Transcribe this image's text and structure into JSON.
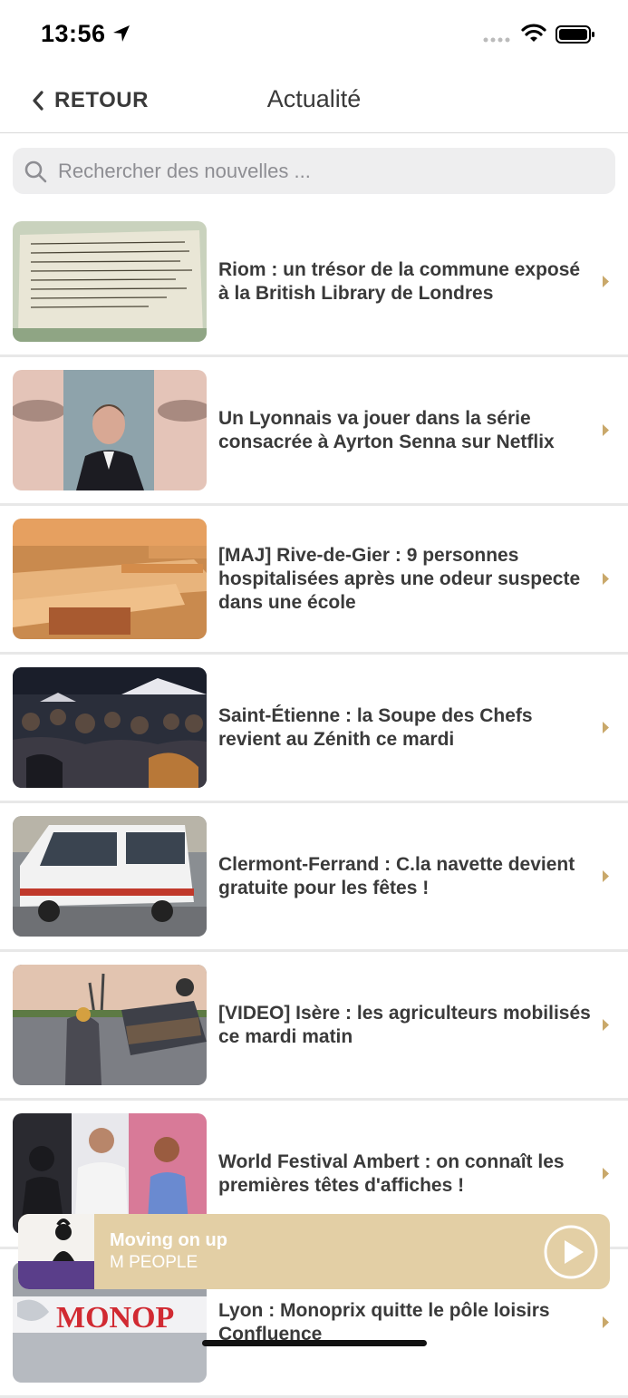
{
  "status_bar": {
    "time": "13:56"
  },
  "nav": {
    "back_label": "RETOUR",
    "title": "Actualité"
  },
  "search": {
    "placeholder": "Rechercher des nouvelles ..."
  },
  "articles": [
    {
      "headline": "Riom : un trésor de la commune exposé à la British Library de Londres",
      "image": "manuscript-photo"
    },
    {
      "headline": "Un Lyonnais va jouer dans la série consacrée à Ayrton Senna sur Netflix",
      "image": "actor-portrait-photo"
    },
    {
      "headline": "[MAJ] Rive-de-Gier : 9 personnes hospitalisées après une odeur suspecte dans une école",
      "image": "classroom-desks-photo"
    },
    {
      "headline": "Saint-Étienne : la Soupe des Chefs revient au Zénith ce mardi",
      "image": "crowd-event-photo"
    },
    {
      "headline": "Clermont-Ferrand : C.la navette devient gratuite pour les fêtes !",
      "image": "shuttle-bus-photo"
    },
    {
      "headline": "[VIDEO] Isère : les agriculteurs mobilisés ce mardi matin",
      "image": "farmers-tractor-photo"
    },
    {
      "headline": "World Festival Ambert : on connaît les premières têtes d'affiches !",
      "image": "festival-artists-photo"
    },
    {
      "headline": "Lyon : Monoprix quitte le pôle loisirs Confluence",
      "image": "monoprix-sign-photo"
    }
  ],
  "player": {
    "track_title": "Moving on up",
    "artist": "M PEOPLE",
    "play_icon": "play-circle-icon"
  },
  "colors": {
    "accent": "#c9a86a",
    "player_bg": "#e3cfa5",
    "text": "#3a3a3a",
    "search_bg": "#eeeeef"
  }
}
